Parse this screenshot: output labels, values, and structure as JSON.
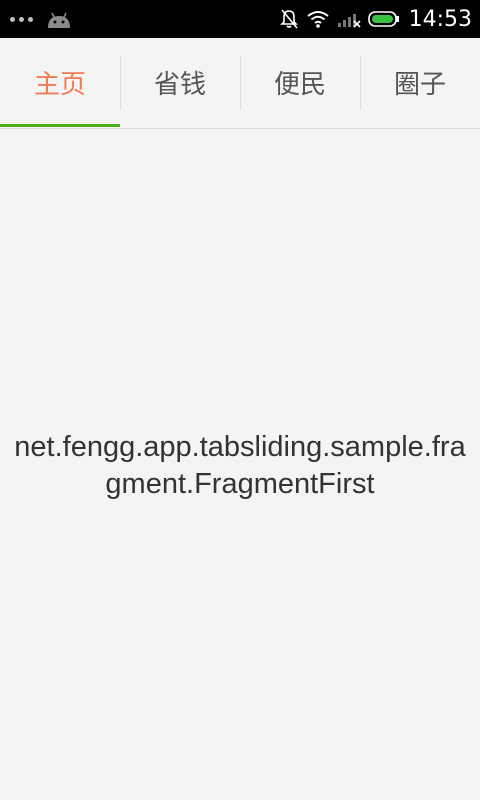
{
  "status_bar": {
    "time": "14:53",
    "icons": [
      "notification-dots-icon",
      "android-icon",
      "bell-muted-icon",
      "wifi-icon",
      "signal-icon",
      "battery-icon"
    ],
    "battery_color": "#3ac043"
  },
  "tabs": [
    {
      "label": "主页",
      "active": true
    },
    {
      "label": "省钱",
      "active": false
    },
    {
      "label": "便民",
      "active": false
    },
    {
      "label": "圈子",
      "active": false
    }
  ],
  "colors": {
    "active_tab_text": "#f07c53",
    "indicator": "#4cb020",
    "background": "#f4f4f4"
  },
  "content": {
    "fragment_text": "net.fengg.app.tabsliding.sample.fragment.FragmentFirst"
  }
}
